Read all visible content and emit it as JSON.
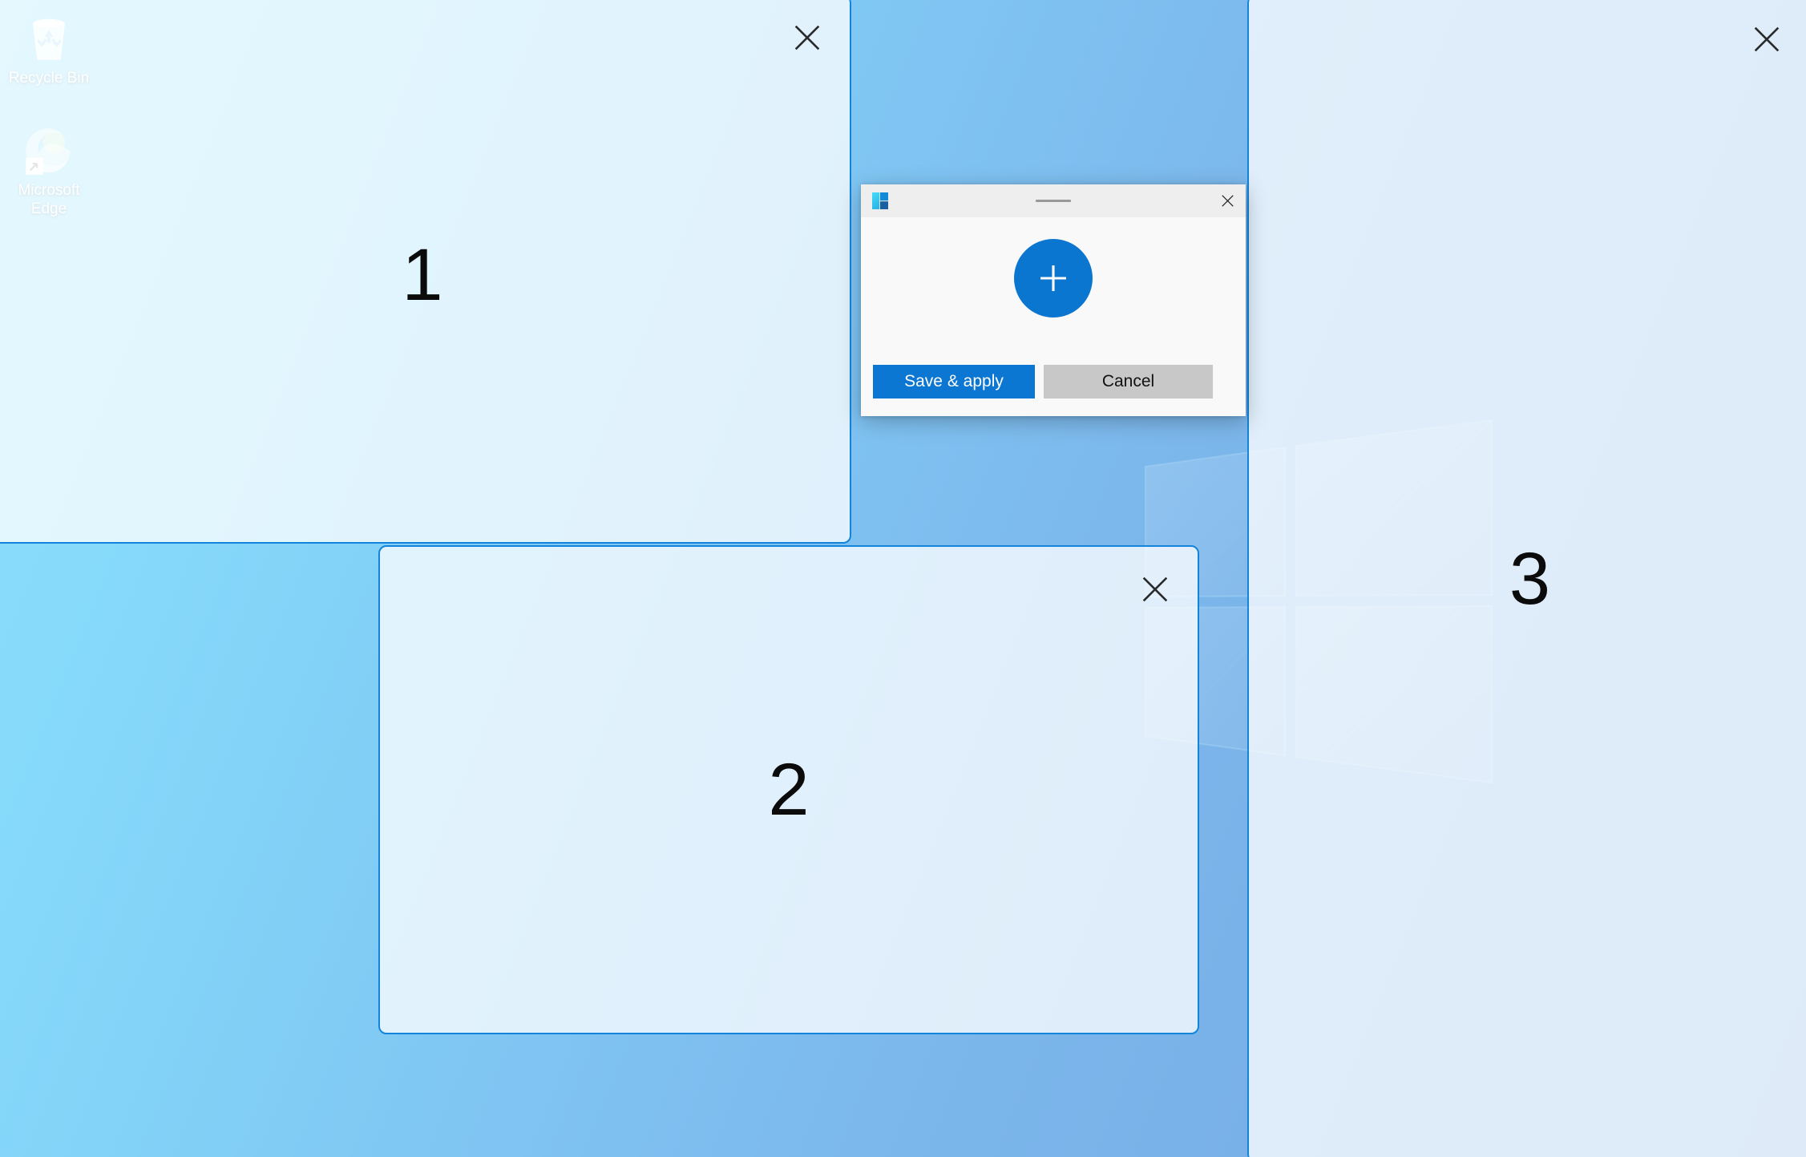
{
  "desktop": {
    "icons": [
      {
        "id": "recycle-bin",
        "label": "Recycle Bin",
        "icon": "recycle-bin-icon"
      },
      {
        "id": "edge",
        "label": "Microsoft Edge",
        "icon": "microsoft-edge-icon"
      }
    ],
    "wallpaper": {
      "name": "windows-10-hero-logo",
      "gradient_start": "#8ddffb",
      "gradient_end": "#74a9e2"
    }
  },
  "zones": [
    {
      "number": "1",
      "close_icon": "close-icon"
    },
    {
      "number": "2",
      "close_icon": "close-icon"
    },
    {
      "number": "3",
      "close_icon": "close-icon"
    }
  ],
  "dialog": {
    "app_icon": "fancyzones-icon",
    "drag_handle": "drag-handle",
    "close_icon": "close-icon",
    "add_zone_icon": "plus-icon",
    "buttons": {
      "save_apply": "Save & apply",
      "cancel": "Cancel"
    }
  },
  "colors": {
    "accent": "#0c76d3",
    "zone_border": "#1284dc",
    "zone_fill": "rgba(255,255,255,0.76)",
    "titlebar": "#eeeeee",
    "dialog_body": "#f9f9f9",
    "cancel_button": "#c8c8c8"
  }
}
